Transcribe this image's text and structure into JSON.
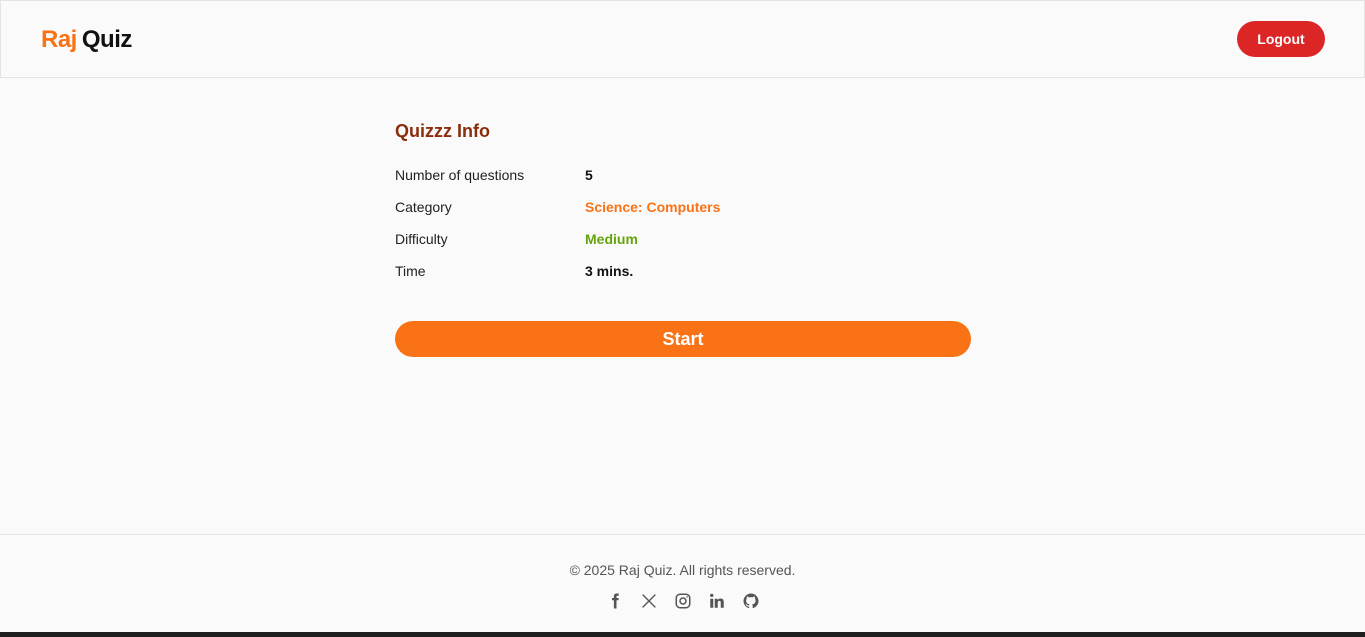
{
  "brand": {
    "part1": "Raj",
    "part2": "Quiz",
    "accent_color": "#f97316"
  },
  "header": {
    "logout_label": "Logout",
    "logout_color": "#dc2626"
  },
  "quiz_info": {
    "title": "Quizzz Info",
    "rows": [
      {
        "label": "Number of questions",
        "value": "5"
      },
      {
        "label": "Category",
        "value": "Science: Computers"
      },
      {
        "label": "Difficulty",
        "value": "Medium"
      },
      {
        "label": "Time",
        "value": "3 mins."
      }
    ],
    "start_label": "Start",
    "category_color": "#f97316",
    "difficulty_color": "#65a30d"
  },
  "footer": {
    "copyright": "© 2025 Raj Quiz. All rights reserved.",
    "social_icons": [
      "facebook-icon",
      "x-icon",
      "instagram-icon",
      "linkedin-icon",
      "github-icon"
    ]
  }
}
